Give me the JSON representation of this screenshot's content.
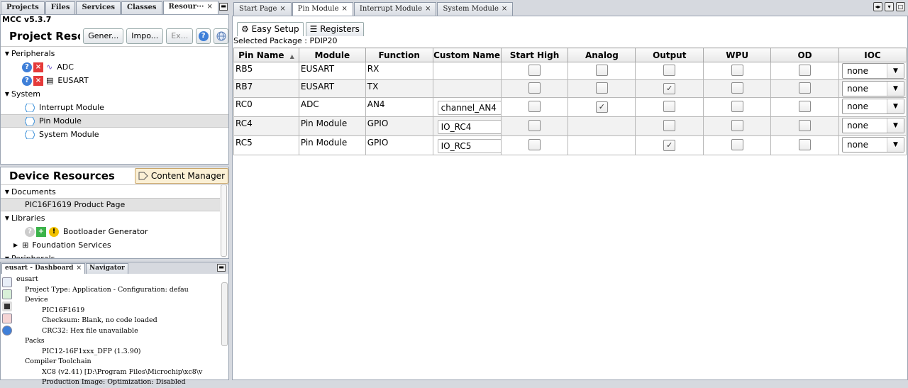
{
  "left_tabs": [
    {
      "label": "Projects"
    },
    {
      "label": "Files"
    },
    {
      "label": "Services"
    },
    {
      "label": "Classes"
    },
    {
      "label": "Resour···",
      "close": "×"
    }
  ],
  "mcc": {
    "version": "MCC v5.3.7",
    "project_resources_title": "Project Resour...",
    "buttons": {
      "generate": "Gener...",
      "import": "Impo...",
      "export": "Ex..."
    },
    "peripherals_label": "Peripherals",
    "peripherals": [
      {
        "name": "ADC"
      },
      {
        "name": "EUSART"
      }
    ],
    "system_label": "System",
    "system_items": [
      {
        "name": "Interrupt Module"
      },
      {
        "name": "Pin Module"
      },
      {
        "name": "System Module"
      }
    ]
  },
  "device_resources": {
    "title": "Device Resources",
    "content_manager": "Content Manager",
    "documents_label": "Documents",
    "documents": [
      {
        "name": "PIC16F1619 Product Page"
      }
    ],
    "libraries_label": "Libraries",
    "libraries": [
      {
        "name": "Bootloader Generator"
      },
      {
        "name": "Foundation Services"
      }
    ],
    "peripherals_label": "Peripherals"
  },
  "dashboard": {
    "tabs": [
      {
        "label": "eusart - Dashboard",
        "close": "×"
      },
      {
        "label": "Navigator"
      }
    ],
    "tree": [
      "eusart",
      "Project Type: Application - Configuration: defau",
      "Device",
      "PIC16F1619",
      "Checksum: Blank, no code loaded",
      "CRC32: Hex file unavailable",
      "Packs",
      "PIC12-16F1xxx_DFP (1.3.90)",
      "Compiler Toolchain",
      "XC8 (v2.41) [D:\\Program Files\\Microchip\\xc8\\v",
      "Production Image: Optimization: Disabled"
    ]
  },
  "editor_tabs": [
    {
      "label": "Start Page",
      "close": "×"
    },
    {
      "label": "Pin Module",
      "close": "×"
    },
    {
      "label": "Interrupt Module",
      "close": "×"
    },
    {
      "label": "System Module",
      "close": "×"
    }
  ],
  "pin_module": {
    "subtabs": {
      "easy_setup": "Easy Setup",
      "registers": "Registers"
    },
    "selected_package": "Selected Package : PDIP20",
    "columns": [
      "Pin Name",
      "Module",
      "Function",
      "Custom Name",
      "Start High",
      "Analog",
      "Output",
      "WPU",
      "OD",
      "IOC"
    ],
    "rows": [
      {
        "pin": "RB5",
        "module": "EUSART",
        "function": "RX",
        "custom": "",
        "start_high": false,
        "analog": false,
        "output": false,
        "wpu": false,
        "od": false,
        "ioc": "none",
        "has_analog": true
      },
      {
        "pin": "RB7",
        "module": "EUSART",
        "function": "TX",
        "custom": "",
        "start_high": false,
        "analog": false,
        "output": true,
        "wpu": false,
        "od": false,
        "ioc": "none",
        "has_analog": true
      },
      {
        "pin": "RC0",
        "module": "ADC",
        "function": "AN4",
        "custom": "channel_AN4",
        "start_high": false,
        "analog": true,
        "output": false,
        "wpu": false,
        "od": false,
        "ioc": "none",
        "has_analog": true
      },
      {
        "pin": "RC4",
        "module": "Pin Module",
        "function": "GPIO",
        "custom": "IO_RC4",
        "start_high": false,
        "analog": false,
        "output": false,
        "wpu": false,
        "od": false,
        "ioc": "none",
        "has_analog": false
      },
      {
        "pin": "RC5",
        "module": "Pin Module",
        "function": "GPIO",
        "custom": "IO_RC5",
        "start_high": false,
        "analog": false,
        "output": true,
        "wpu": false,
        "od": false,
        "ioc": "none",
        "has_analog": false
      }
    ]
  },
  "colors": {
    "accent": "#3f7fd8",
    "error": "#e53a3a",
    "content_manager_bg": "#fbf0d5"
  }
}
